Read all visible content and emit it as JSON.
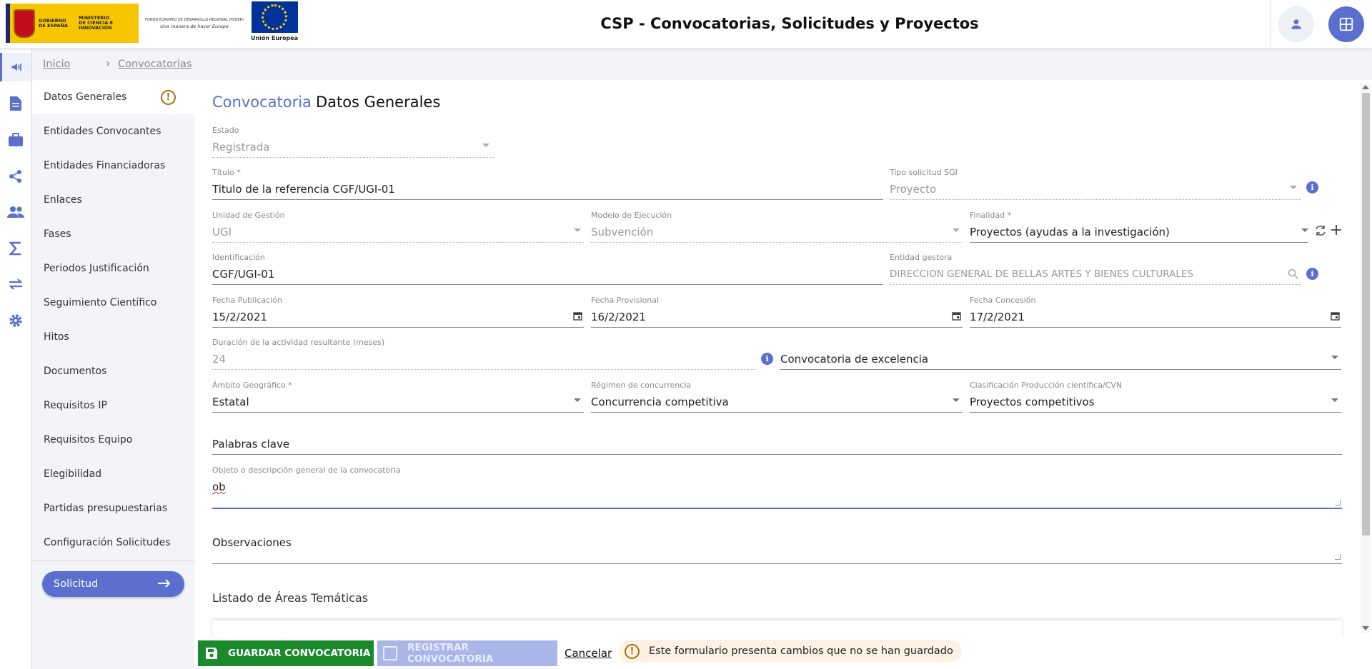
{
  "header": {
    "app_title": "CSP - Convocatorias, Solicitudes y Proyectos",
    "logo_gobierno": "GOBIERNO DE ESPAÑA",
    "logo_ministerio": "MINISTERIO DE CIENCIA E INNOVACIÓN",
    "logo_feder_line1": "FONDO EUROPEO DE DESARROLLO REGIONAL (FEDER)",
    "logo_feder_line2": "Una manera de hacer Europa",
    "logo_eu": "Unión Europea"
  },
  "rail": [
    {
      "icon": "megaphone-icon",
      "active": true
    },
    {
      "icon": "document-icon"
    },
    {
      "icon": "briefcase-icon"
    },
    {
      "icon": "share-icon"
    },
    {
      "icon": "people-icon"
    },
    {
      "icon": "sigma-icon"
    },
    {
      "icon": "swap-arrows-icon"
    },
    {
      "icon": "gear-icon"
    }
  ],
  "breadcrumb": {
    "home": "Inicio",
    "current": "Convocatorias"
  },
  "section_nav": {
    "items": [
      "Datos Generales",
      "Entidades Convocantes",
      "Entidades Financiadoras",
      "Enlaces",
      "Fases",
      "Periodos Justificación",
      "Seguimiento Científico",
      "Hitos",
      "Documentos",
      "Requisitos IP",
      "Requisitos Equipo",
      "Elegibilidad",
      "Partidas presupuestarias",
      "Configuración Solicitudes"
    ],
    "warning_glyph": "!",
    "solicitud_label": "Solicitud"
  },
  "form": {
    "title_accent": "Convocatoria",
    "title_rest": "Datos Generales",
    "estado": {
      "label": "Estado",
      "value": "Registrada"
    },
    "titulo": {
      "label": "Título *",
      "value": "Titulo de la referencia CGF/UGI-01"
    },
    "tipo_solicitud": {
      "label": "Tipo solicitud SGI",
      "value": "Proyecto"
    },
    "unidad_gestion": {
      "label": "Unidad de Gestión",
      "value": "UGI"
    },
    "modelo_ejecucion": {
      "label": "Modelo de Ejecución",
      "value": "Subvención"
    },
    "finalidad": {
      "label": "Finalidad *",
      "value": "Proyectos (ayudas a la investigación)"
    },
    "identificacion": {
      "label": "Identificación",
      "value": "CGF/UGI-01"
    },
    "entidad_gestora": {
      "label": "Entidad gestora",
      "value": "DIRECCION GENERAL DE BELLAS ARTES Y BIENES CULTURALES"
    },
    "fecha_publicacion": {
      "label": "Fecha Publicación",
      "value": "15/2/2021"
    },
    "fecha_provisional": {
      "label": "Fecha Provisional",
      "value": "16/2/2021"
    },
    "fecha_concesion": {
      "label": "Fecha Concesión",
      "value": "17/2/2021"
    },
    "duracion": {
      "label": "Duración de la actividad resultante (meses)",
      "value": "24"
    },
    "excelencia": {
      "label": "Convocatoria de excelencia"
    },
    "ambito": {
      "label": "Ámbito Geográfico *",
      "value": "Estatal"
    },
    "regimen": {
      "label": "Régimen de concurrencia",
      "value": "Concurrencia competitiva"
    },
    "clasificacion": {
      "label": "Clasificación Producción científica/CVN",
      "value": "Proyectos competitivos"
    },
    "palabras_clave": {
      "label": "Palabras clave"
    },
    "objeto": {
      "label": "Objeto o descripción general de la convocatoria",
      "value": "ob"
    },
    "observaciones": {
      "label": "Observaciones"
    },
    "info_glyph": "i",
    "list_title": "Listado de Áreas Temáticas"
  },
  "footer": {
    "save_label": "GUARDAR CONVOCATORIA",
    "register_label": "REGISTRAR CONVOCATORIA",
    "cancel_label": "Cancelar",
    "unsaved_message": "Este formulario presenta cambios que no se han guardado",
    "warning_glyph": "!"
  },
  "colors": {
    "accent": "#5b6fcf",
    "save_green": "#1a8a2d",
    "register_disabled": "#aab5e8",
    "warning": "#a8700b",
    "nav_background": "#f3f4f8"
  }
}
